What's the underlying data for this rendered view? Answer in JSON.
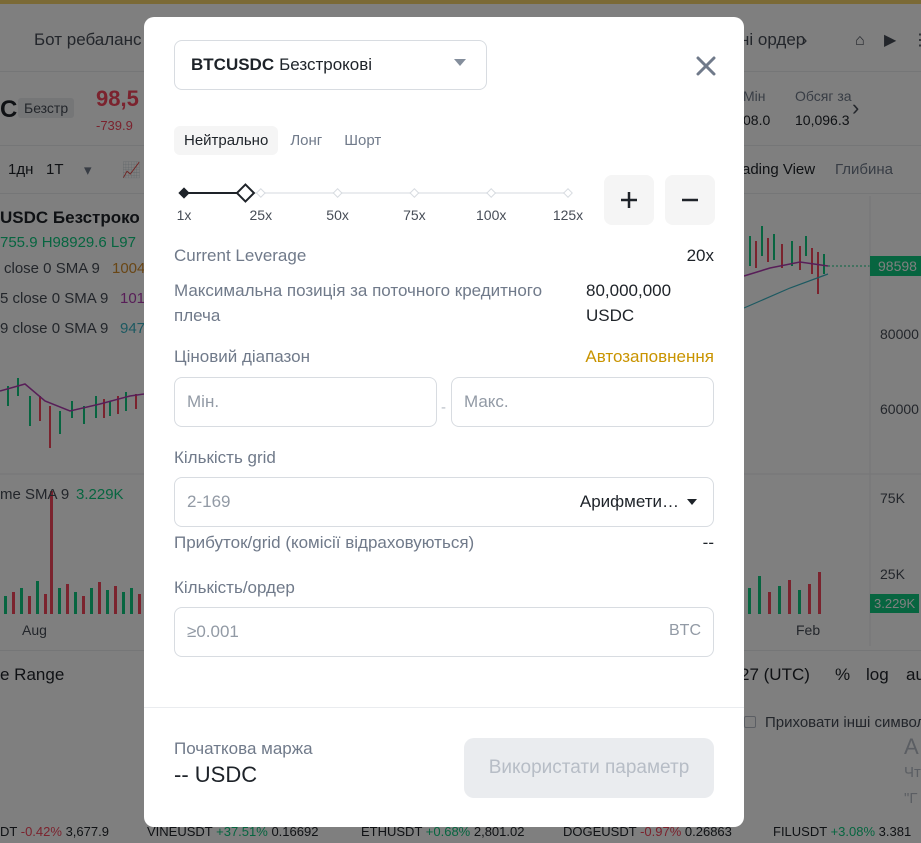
{
  "background": {
    "nav": {
      "left_item": "Бот ребаланс",
      "right_item": "ні ордер"
    },
    "ticker": {
      "symbol_partial": "C",
      "symbol_tag": "Безстр",
      "price": "98,5",
      "change": "-739.9",
      "stat_min_label": "Мін",
      "stat_min_value": "08.0",
      "stat_volume_label": "Обсяг за",
      "stat_volume_value": "10,096.3"
    },
    "toolbar": {
      "interval_1d": "1дн",
      "interval_1t": "1Т",
      "trading_view": "ading View",
      "depth": "Глибина"
    },
    "chart": {
      "title": "USDC Безстроко",
      "ohlc": "755.9  H98929.6  L97",
      "ind1": "close 0 SMA 9",
      "ind1_val": "1004",
      "ind2": "5 close 0 SMA 9",
      "ind2_val": "101",
      "ind3": "9 close 0 SMA 9",
      "ind3_val": "947",
      "price_tag": "98598",
      "axis_80": "80000",
      "axis_60": "60000",
      "vol_label": "me SMA 9",
      "vol_value": "3.229K",
      "axis_75k": "75K",
      "axis_25k": "25K",
      "vol_tag": "3.229K",
      "x_aug": "Aug",
      "x_feb": "Feb"
    },
    "bottom": {
      "range": "e Range",
      "time": "27 (UTC)",
      "pct": "%",
      "log": "log",
      "auto": "au",
      "hide_others": "Приховати інші символ"
    },
    "footer": [
      {
        "sym": "DT",
        "chg": "-0.42%",
        "price": "3,677.9",
        "color": "#f6465d"
      },
      {
        "sym": "VINEUSDT",
        "chg": "+37.51%",
        "price": "0.16692",
        "color": "#0ecb81"
      },
      {
        "sym": "ETHUSDT",
        "chg": "+0.68%",
        "price": "2,801.02",
        "color": "#0ecb81"
      },
      {
        "sym": "DOGEUSDT",
        "chg": "-0.97%",
        "price": "0.26863",
        "color": "#f6465d"
      },
      {
        "sym": "FILUSDT",
        "chg": "+3.08%",
        "price": "3.381",
        "color": "#0ecb81"
      }
    ],
    "side_text": [
      "А",
      "Чт",
      "\"Г"
    ]
  },
  "modal": {
    "symbol_bold": "BTCUSDC",
    "symbol_suffix": "Безстрокові",
    "tabs": [
      {
        "label": "Нейтрально",
        "active": true
      },
      {
        "label": "Лонг",
        "active": false
      },
      {
        "label": "Шорт",
        "active": false
      }
    ],
    "leverage": {
      "ticks": [
        "1x",
        "25x",
        "50x",
        "75x",
        "100x",
        "125x"
      ],
      "current_fraction": 0.16
    },
    "current_leverage_label": "Current Leverage",
    "current_leverage_value": "20x",
    "max_position_label": "Максимальна позиція за поточного кредитного плеча",
    "max_position_value": "80,000,000 USDC",
    "price_range_label": "Ціновий діапазон",
    "autofill_label": "Автозаповнення",
    "min_placeholder": "Мін.",
    "max_placeholder": "Макс.",
    "range_separator": "-",
    "grid_count_label": "Кількість grid",
    "grid_placeholder": "2-169",
    "grid_mode": "Арифмети…",
    "profit_label": "Прибуток/grid (комісії відраховуються)",
    "profit_value": "--",
    "qty_label": "Кількість/ордер",
    "qty_placeholder": "≥0.001",
    "qty_unit": "BTC",
    "initial_margin_label": "Початкова маржа",
    "initial_margin_value": "-- USDC",
    "use_button": "Використати параметр"
  },
  "colors": {
    "accent": "#c99400",
    "up": "#0ecb81",
    "down": "#f6465d",
    "overlay": "rgba(0,0,0,0.5)"
  }
}
